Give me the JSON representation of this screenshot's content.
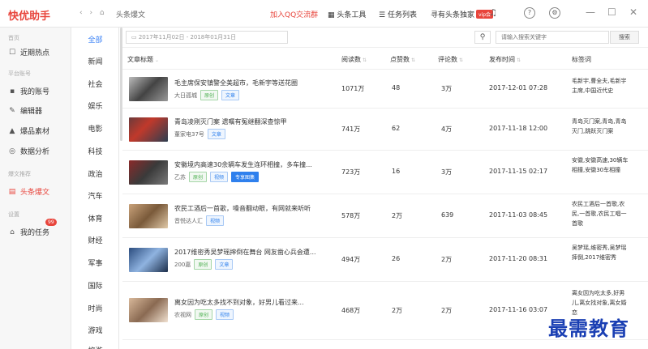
{
  "app": {
    "title": "快优助手",
    "nav_buttons": "‹ › ⌂",
    "breadcrumb": "头条爆文"
  },
  "topbar": {
    "qq_group": "加入QQ交流群",
    "toolbox": "头条工具",
    "task_list": "任务列表",
    "vip_text": "寻有头条独家",
    "vip_badge": "vip会"
  },
  "sidebar": {
    "sections": [
      "首页",
      "平台账号",
      "爆文推荐",
      "设置"
    ],
    "items": [
      {
        "label": "近期热点",
        "icon": "clipboard-icon"
      },
      {
        "label": "我的账号",
        "icon": "grid-icon"
      },
      {
        "label": "编辑器",
        "icon": "edit-icon"
      },
      {
        "label": "爆品素材",
        "icon": "home-icon"
      },
      {
        "label": "数据分析",
        "icon": "eye-icon"
      },
      {
        "label": "头条爆文",
        "icon": "document-icon"
      },
      {
        "label": "我的任务",
        "icon": "home-outline-icon"
      }
    ],
    "badge": "99"
  },
  "categories": [
    "全部",
    "新闻",
    "社会",
    "娱乐",
    "电影",
    "科技",
    "政治",
    "汽车",
    "体育",
    "财经",
    "军事",
    "国际",
    "时尚",
    "游戏",
    "旅游"
  ],
  "filter": {
    "date_range": "2017年11月02日 - 2018年01月31日",
    "search_placeholder": "请输入搜索关键字",
    "search_button": "搜索"
  },
  "table": {
    "headers": [
      "文章标题",
      "阅读数",
      "点赞数",
      "评论数",
      "发布时间",
      "标签词"
    ],
    "rows": [
      {
        "title": "毛主席保安镇警全美超市，毛新宇等送花圈",
        "source": "大日孤城",
        "tags": [
          {
            "t": "原创",
            "c": "g"
          },
          {
            "t": "文章",
            "c": "b"
          }
        ],
        "reads": "1071万",
        "likes": "48",
        "comments": "3万",
        "time": "2017-12-01 07:28",
        "keywords": "毛新宇,曹全夫,毛新宇主席,中国近代史"
      },
      {
        "title": "青岛凌刚灭门案 遗嘱有冤继翻深查惊甲",
        "source": "董家电37号",
        "tags": [
          {
            "t": "文章",
            "c": "b"
          }
        ],
        "reads": "741万",
        "likes": "62",
        "comments": "4万",
        "time": "2017-11-18 12:00",
        "keywords": "青岛灭门案,青岛,青岛灭门,跳跃灭门案"
      },
      {
        "title": "安徽境内高速30余辆车发生连环相撞，多车撞...",
        "source": "乙苏",
        "tags": [
          {
            "t": "原创",
            "c": "g"
          },
          {
            "t": "视频",
            "c": "b"
          },
          {
            "t": "专享图集",
            "c": "s"
          }
        ],
        "reads": "723万",
        "likes": "16",
        "comments": "3万",
        "time": "2017-11-15 02:17",
        "keywords": "安徽,安徽高速,30辆车相撞,安徽30车相撞"
      },
      {
        "title": "农民工酒后一首歌，嗓音翻动眼，有网就来听听",
        "source": "音悦达人汇",
        "tags": [
          {
            "t": "视频",
            "c": "b"
          }
        ],
        "reads": "578万",
        "likes": "2万",
        "comments": "639",
        "time": "2017-11-03 08:45",
        "keywords": "农民工酒后一首歌,农民,一首歌,农民工唱一首歌"
      },
      {
        "title": "2017维密秀吴梦瑶摔倒在舞台 网友凿心兵会遭...",
        "source": "200嘉",
        "tags": [
          {
            "t": "原创",
            "c": "g"
          },
          {
            "t": "文章",
            "c": "b"
          }
        ],
        "reads": "494万",
        "likes": "26",
        "comments": "2万",
        "time": "2017-11-20 08:31",
        "keywords": "吴梦瑶,维密秀,吴梦瑶摔倒,2017维密秀"
      },
      {
        "title": "离女因为吃太多找不到对象，好男儿看过来...",
        "source": "农视网",
        "tags": [
          {
            "t": "原创",
            "c": "g"
          },
          {
            "t": "视频",
            "c": "b"
          }
        ],
        "reads": "468万",
        "likes": "2万",
        "comments": "2万",
        "time": "2017-11-16 03:07",
        "keywords": "离女因为吃太多,好男儿,离女找对象,离女婚恋"
      }
    ]
  },
  "watermark": "最需教育",
  "colors": {
    "brand": "#e8453c",
    "accent": "#3b82f6"
  }
}
